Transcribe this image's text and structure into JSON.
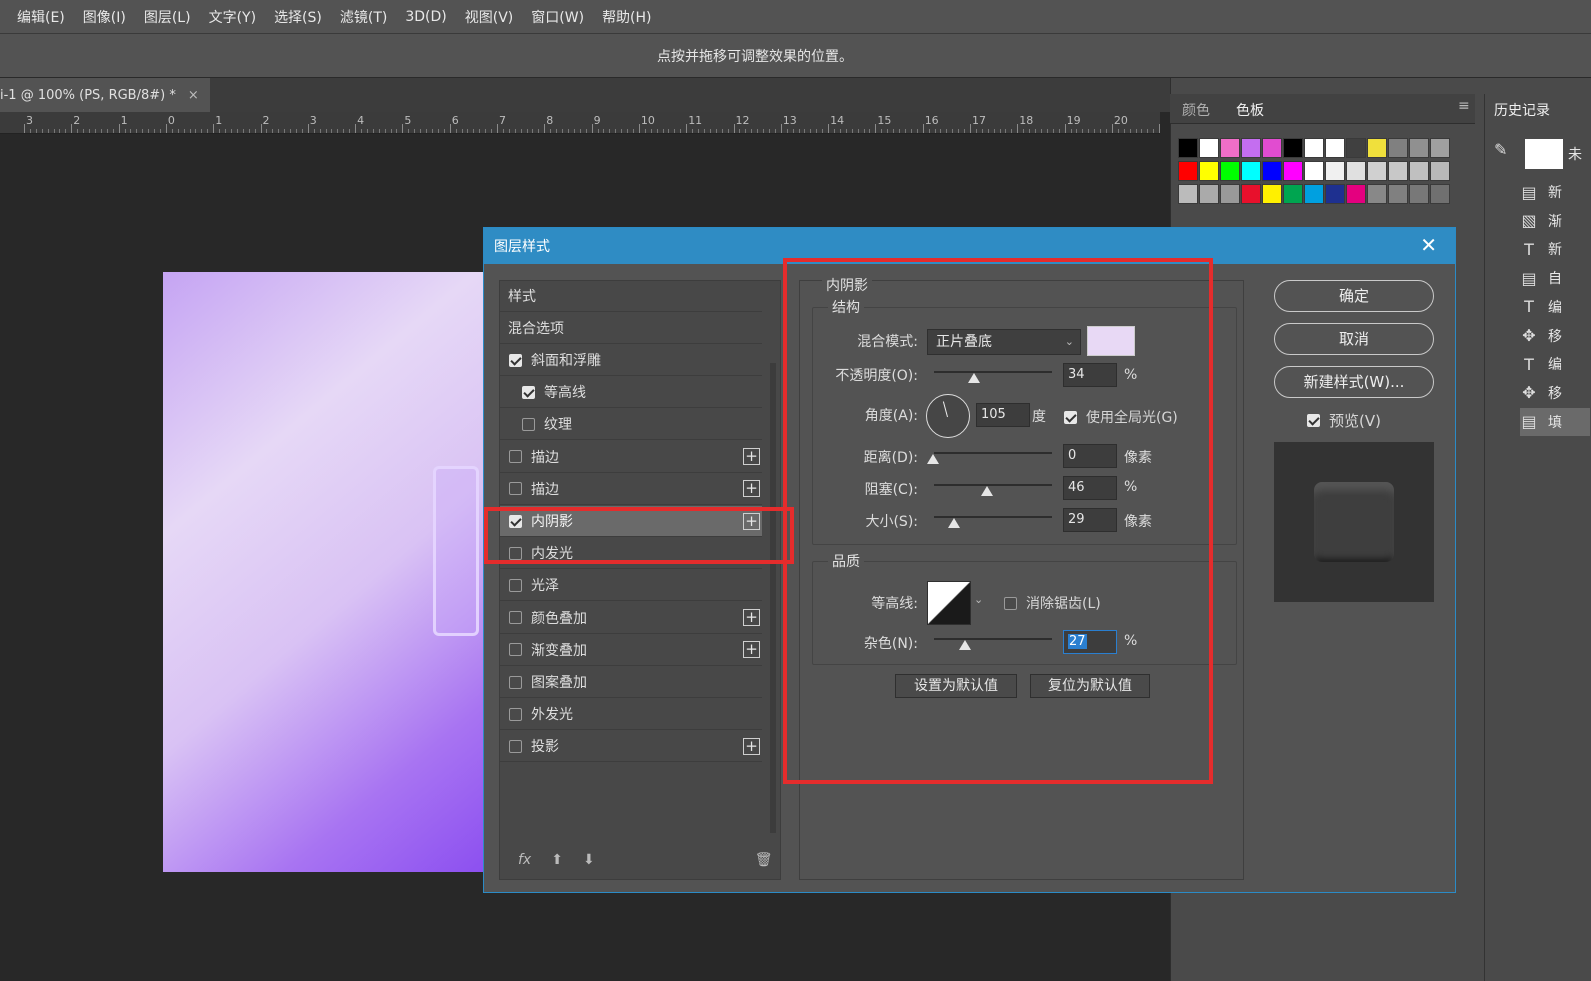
{
  "menu": [
    "编辑(E)",
    "图像(I)",
    "图层(L)",
    "文字(Y)",
    "选择(S)",
    "滤镜(T)",
    "3D(D)",
    "视图(V)",
    "窗口(W)",
    "帮助(H)"
  ],
  "options_hint": "点按并拖移可调整效果的位置。",
  "document_tab": {
    "title": "i-1 @ 100% (PS, RGB/8#) *",
    "close": "×"
  },
  "ruler_labels": [
    "3",
    "2",
    "1",
    "0",
    "1",
    "2",
    "3",
    "4",
    "5",
    "6",
    "7",
    "8",
    "9",
    "10",
    "11",
    "12",
    "13",
    "14",
    "15",
    "16",
    "17",
    "18",
    "19",
    "20",
    "2"
  ],
  "swatch_panel": {
    "tabs": [
      "颜色",
      "色板"
    ],
    "rows": [
      [
        "#000000",
        "#ffffff",
        "#f06ec8",
        "#c46ef0",
        "#e14cd0",
        "#000000",
        "#ffffff",
        "#ffffff",
        "#404040",
        "#f0e03c",
        "#808080",
        "#909090",
        "#a0a0a0"
      ],
      [
        "#ff0000",
        "#ffff00",
        "#00ff00",
        "#00ffff",
        "#0000ff",
        "#ff00ff",
        "#ffffff",
        "#f0f0f0",
        "#e0e0e0",
        "#d0d0d0",
        "#c8c8c8",
        "#c0c0c0",
        "#b8b8b8"
      ],
      [
        "#bbbbbb",
        "#aaaaaa",
        "#999999",
        "#e8102c",
        "#fff000",
        "#00a550",
        "#00a0e0",
        "#1e3090",
        "#e4007f",
        "#888888",
        "#808080",
        "#787878",
        "#707070"
      ]
    ]
  },
  "history_panel": {
    "title": "历史记录",
    "items": [
      "未",
      "新",
      "渐",
      "新",
      "自",
      "编",
      "移",
      "编",
      "移",
      "填"
    ]
  },
  "dialog": {
    "title": "图层样式",
    "close": "✕",
    "styles_header": "样式",
    "blend_options": "混合选项",
    "styles": [
      {
        "label": "斜面和浮雕",
        "checked": true,
        "indent": 0,
        "plus": false
      },
      {
        "label": "等高线",
        "checked": true,
        "indent": 1,
        "plus": false
      },
      {
        "label": "纹理",
        "checked": false,
        "indent": 1,
        "plus": false
      },
      {
        "label": "描边",
        "checked": false,
        "indent": 0,
        "plus": true
      },
      {
        "label": "描边",
        "checked": false,
        "indent": 0,
        "plus": true
      },
      {
        "label": "内阴影",
        "checked": true,
        "indent": 0,
        "plus": true,
        "selected": true
      },
      {
        "label": "内发光",
        "checked": false,
        "indent": 0,
        "plus": false
      },
      {
        "label": "光泽",
        "checked": false,
        "indent": 0,
        "plus": false
      },
      {
        "label": "颜色叠加",
        "checked": false,
        "indent": 0,
        "plus": true
      },
      {
        "label": "渐变叠加",
        "checked": false,
        "indent": 0,
        "plus": true
      },
      {
        "label": "图案叠加",
        "checked": false,
        "indent": 0,
        "plus": false
      },
      {
        "label": "外发光",
        "checked": false,
        "indent": 0,
        "plus": false
      },
      {
        "label": "投影",
        "checked": false,
        "indent": 0,
        "plus": true
      }
    ],
    "footer_fx": "fx",
    "section_title": "内阴影",
    "structure": {
      "legend": "结构",
      "blend_mode_label": "混合模式:",
      "blend_mode_value": "正片叠底",
      "color": "#e8d9f5",
      "opacity_label": "不透明度(O):",
      "opacity": "34",
      "opacity_unit": "%",
      "angle_label": "角度(A):",
      "angle": "105",
      "angle_unit": "度",
      "global_light_label": "使用全局光(G)",
      "global_light": true,
      "distance_label": "距离(D):",
      "distance": "0",
      "distance_unit": "像素",
      "choke_label": "阻塞(C):",
      "choke": "46",
      "choke_unit": "%",
      "size_label": "大小(S):",
      "size": "29",
      "size_unit": "像素"
    },
    "quality": {
      "legend": "品质",
      "contour_label": "等高线:",
      "antialias_label": "消除锯齿(L)",
      "antialias": false,
      "noise_label": "杂色(N):",
      "noise": "27",
      "noise_unit": "%"
    },
    "set_default": "设置为默认值",
    "reset_default": "复位为默认值",
    "ok": "确定",
    "cancel": "取消",
    "new_style": "新建样式(W)...",
    "preview_label": "预览(V)",
    "preview_checked": true
  }
}
